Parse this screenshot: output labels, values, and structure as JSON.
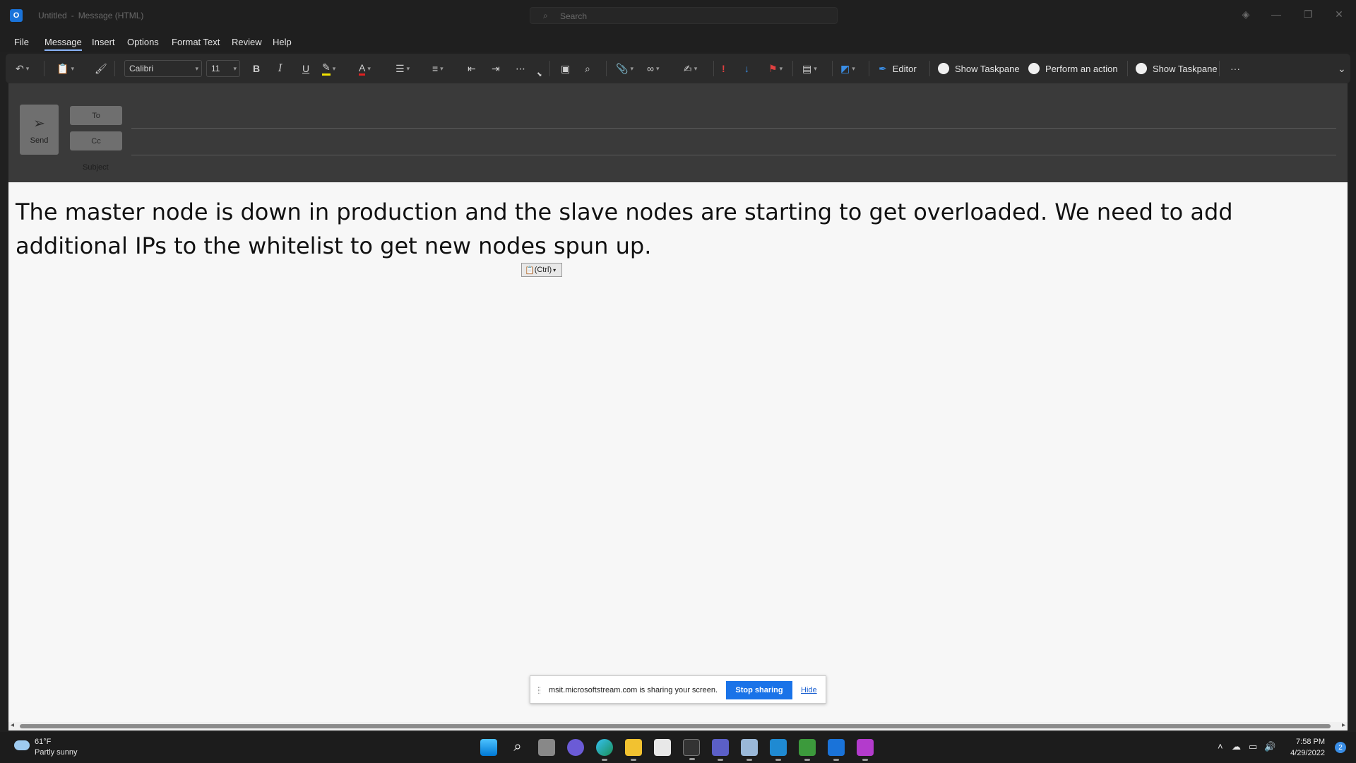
{
  "window": {
    "title_doc": "Untitled",
    "title_sep": "-",
    "title_type": "Message (HTML)",
    "search_placeholder": "Search"
  },
  "menu": [
    "File",
    "Message",
    "Insert",
    "Options",
    "Format Text",
    "Review",
    "Help"
  ],
  "ribbon": {
    "font_name": "Calibri",
    "font_size": "11",
    "bold": "B",
    "italic": "I",
    "underline": "U",
    "font_color_letter": "A",
    "editor_label": "Editor",
    "show_taskpane_1": "Show Taskpane",
    "perform_action": "Perform an action",
    "show_taskpane_2": "Show Taskpane",
    "more": "···"
  },
  "compose": {
    "send_label": "Send",
    "to_label": "To",
    "cc_label": "Cc",
    "subject_label": "Subject",
    "body_text": "The master node is down in production and the slave nodes are starting to get overloaded. We need to add additional IPs to the whitelist to get new nodes spun up.",
    "paste_options": "(Ctrl)"
  },
  "share_bar": {
    "message": "msit.microsoftstream.com is sharing your screen.",
    "stop_label": "Stop sharing",
    "hide_label": "Hide"
  },
  "taskbar": {
    "temp": "61°F",
    "weather": "Partly sunny",
    "time": "7:58 PM",
    "date": "4/29/2022",
    "notifications": "2"
  },
  "colors": {
    "accent_blue": "#1a73e8",
    "body_bg": "#f7f7f7",
    "ribbon_bg": "#2b2b2b"
  }
}
